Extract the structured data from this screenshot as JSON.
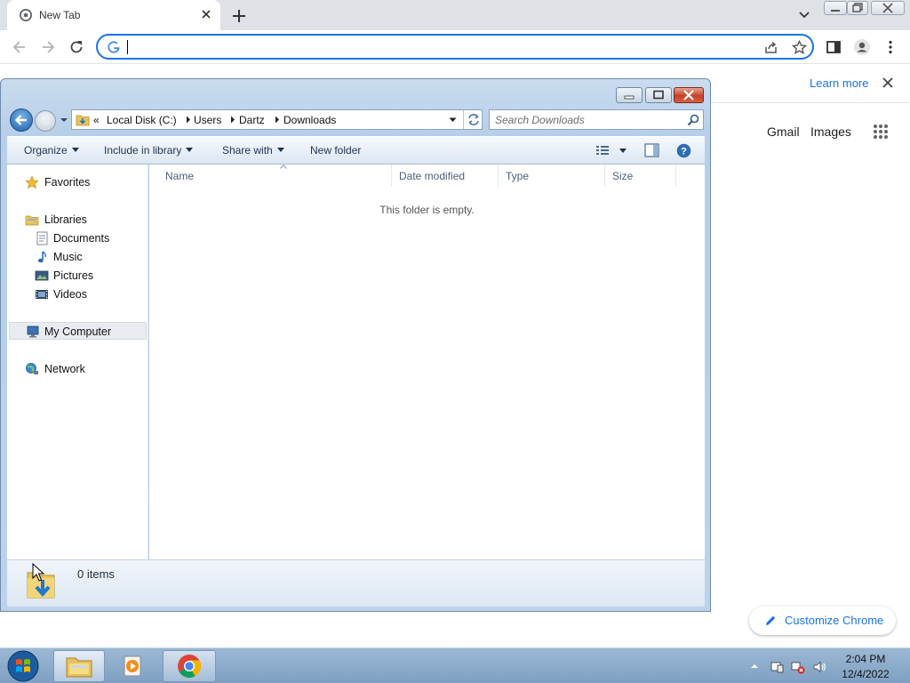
{
  "browser": {
    "tab_title": "New Tab",
    "omnibox_value": "",
    "ntp": {
      "learn_more": "Learn more",
      "gmail": "Gmail",
      "images": "Images",
      "customize": "Customize Chrome"
    },
    "colors": {
      "accent": "#1a73e8",
      "tabstrip": "#dee1e6"
    }
  },
  "explorer": {
    "address": {
      "overflow": "«",
      "segments": [
        "Local Disk (C:)",
        "Users",
        "Dartz",
        "Downloads"
      ]
    },
    "search_placeholder": "Search Downloads",
    "commands": {
      "organize": "Organize",
      "include_in_library": "Include in library",
      "share_with": "Share with",
      "new_folder": "New folder"
    },
    "nav": {
      "favorites": "Favorites",
      "libraries": "Libraries",
      "documents": "Documents",
      "music": "Music",
      "pictures": "Pictures",
      "videos": "Videos",
      "my_computer": "My Computer",
      "network": "Network"
    },
    "columns": [
      "Name",
      "Date modified",
      "Type",
      "Size"
    ],
    "empty_message": "This folder is empty.",
    "item_count": "0 items"
  },
  "taskbar": {
    "time": "2:04 PM",
    "date": "12/4/2022"
  }
}
